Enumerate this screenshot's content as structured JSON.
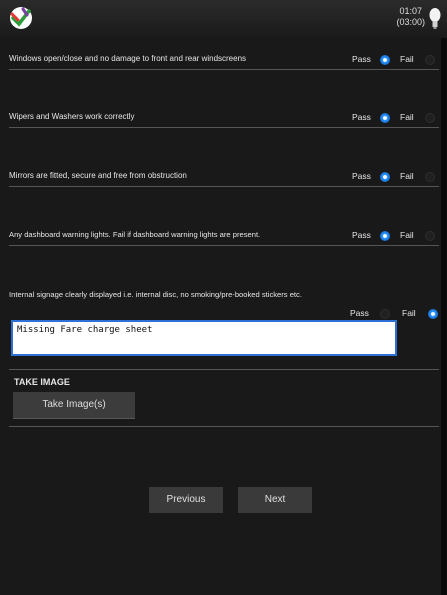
{
  "header": {
    "time": "01:07",
    "remaining": "(03:00)"
  },
  "questions": [
    {
      "text": "Windows open/close and no damage to front and rear windscreens",
      "pass_label": "Pass",
      "fail_label": "Fail",
      "selected": "pass"
    },
    {
      "text": "Wipers and Washers work correctly",
      "pass_label": "Pass",
      "fail_label": "Fail",
      "selected": "pass"
    },
    {
      "text": "Mirrors are fitted, secure and free from obstruction",
      "pass_label": "Pass",
      "fail_label": "Fail",
      "selected": "pass"
    },
    {
      "text": "Any dashboard warning lights. Fail if dashboard warning lights are present.",
      "pass_label": "Pass",
      "fail_label": "Fail",
      "selected": "pass"
    },
    {
      "text": "Internal signage clearly displayed i.e. internal disc, no smoking/pre-booked stickers etc.",
      "pass_label": "Pass",
      "fail_label": "Fail",
      "selected": "fail"
    }
  ],
  "notes": {
    "value": "Missing Fare charge sheet"
  },
  "image_section": {
    "heading": "TAKE IMAGE",
    "button_label": "Take Image(s)"
  },
  "navigation": {
    "previous_label": "Previous",
    "next_label": "Next"
  },
  "colors": {
    "accent": "#1e90ff",
    "background": "#191919"
  }
}
